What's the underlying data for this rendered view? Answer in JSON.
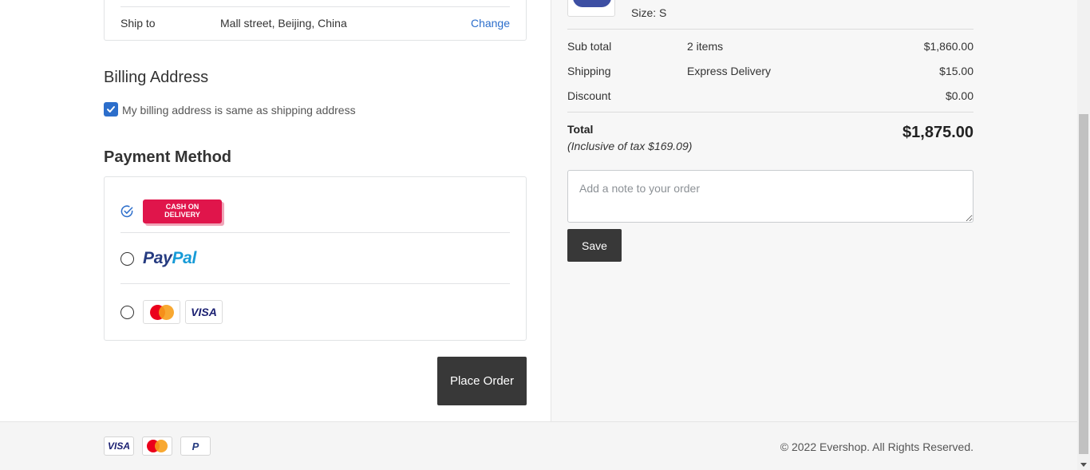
{
  "shipping": {
    "label": "Ship to",
    "address": "Mall street, Beijing, China",
    "change_label": "Change"
  },
  "billing": {
    "title": "Billing Address",
    "same_as_shipping_label": "My billing address is same as shipping address",
    "same_as_shipping_checked": true
  },
  "payment": {
    "title": "Payment Method",
    "methods": [
      {
        "name": "Cash on Delivery",
        "logo_text_line1": "CASH ON",
        "logo_text_line2": "DELIVERY",
        "selected": true
      },
      {
        "name": "PayPal",
        "logo_text_part1": "Pay",
        "logo_text_part2": "Pal",
        "selected": false
      },
      {
        "name": "Credit Card",
        "visa_text": "VISA",
        "selected": false
      }
    ]
  },
  "place_order_label": "Place Order",
  "summary": {
    "item_size": "Size: S",
    "subtotal": {
      "label": "Sub total",
      "detail": "2 items",
      "value": "$1,860.00"
    },
    "shipping": {
      "label": "Shipping",
      "detail": "Express Delivery",
      "value": "$15.00"
    },
    "discount": {
      "label": "Discount",
      "value": "$0.00"
    },
    "total": {
      "label": "Total",
      "tax_note": "(Inclusive of tax $169.09)",
      "value": "$1,875.00"
    }
  },
  "note": {
    "placeholder": "Add a note to your order",
    "save_label": "Save"
  },
  "footer": {
    "visa_text": "VISA",
    "paypal_text": "P",
    "copyright": "© 2022 Evershop. All Rights Reserved."
  },
  "colors": {
    "accent": "#2c6ecb",
    "button": "#383838",
    "cod": "#e0154b"
  }
}
